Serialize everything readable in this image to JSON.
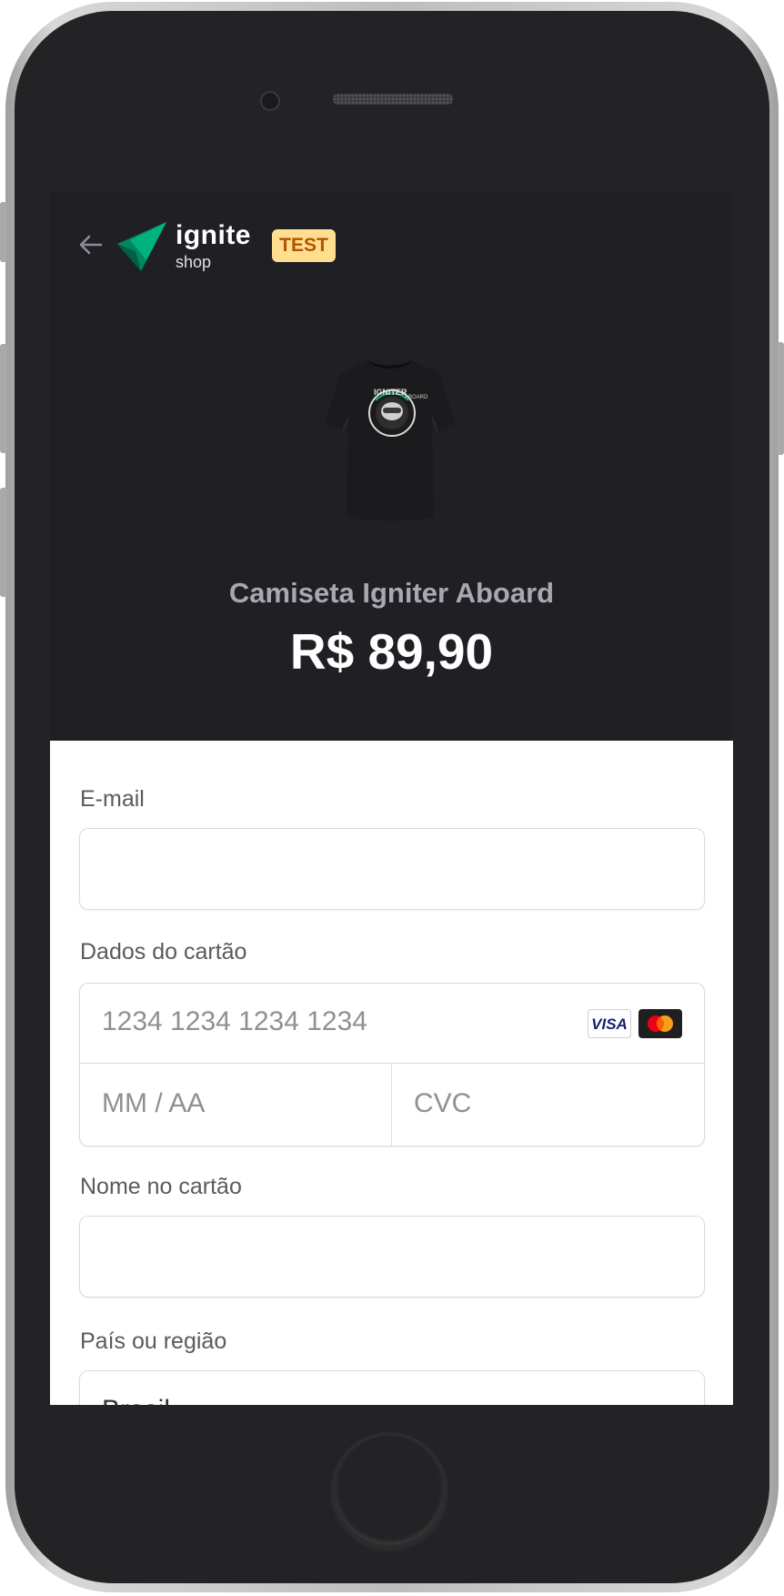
{
  "header": {
    "brand_name": "ignite",
    "brand_sub": "shop",
    "test_badge": "TEST"
  },
  "product": {
    "name": "Camiseta Igniter Aboard",
    "price": "R$ 89,90"
  },
  "form": {
    "email_label": "E-mail",
    "email_value": "",
    "card_label": "Dados do cartão",
    "card_number_placeholder": "1234 1234 1234 1234",
    "expiry_placeholder": "MM / AA",
    "cvc_placeholder": "CVC",
    "card_brands": [
      "VISA",
      "mastercard"
    ],
    "name_label": "Nome no cartão",
    "name_value": "",
    "country_label": "País ou região",
    "country_value": "Brasil"
  },
  "colors": {
    "header_bg": "#202024",
    "badge_bg": "#ffde8f",
    "badge_text": "#b35400",
    "brand_green": "#00b37e"
  },
  "icons": [
    "arrow-left-icon",
    "ignite-logo-icon",
    "tshirt-image",
    "visa-icon",
    "mastercard-icon"
  ]
}
